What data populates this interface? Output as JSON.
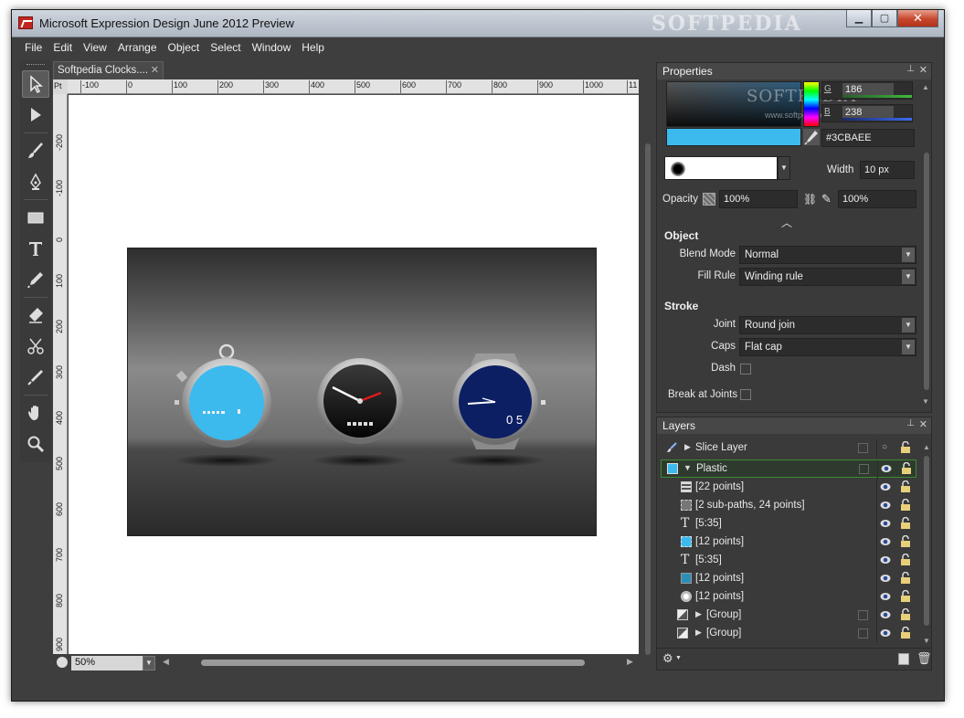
{
  "window": {
    "title": "Microsoft Expression Design June 2012 Preview",
    "watermark": "SOFTPEDIA",
    "buttons": {
      "minimize": "▁",
      "maximize": "▢",
      "close": "✕"
    }
  },
  "menu": [
    "File",
    "Edit",
    "View",
    "Arrange",
    "Object",
    "Select",
    "Window",
    "Help"
  ],
  "tools": [
    "selection",
    "direct-selection",
    "brush",
    "pen",
    "rectangle",
    "text",
    "eyedropper",
    "eraser",
    "scissors",
    "pipette",
    "hand",
    "zoom"
  ],
  "document": {
    "tab_title": "Softpedia Clocks....",
    "tab_close": "✕",
    "ruler_unit": "Pt",
    "ruler_h": [
      "-100",
      "0",
      "100",
      "200",
      "300",
      "400",
      "500",
      "600",
      "700",
      "800",
      "900",
      "1000",
      "11"
    ],
    "ruler_v": [
      "-200",
      "-100",
      "0",
      "100",
      "200",
      "300",
      "400",
      "500",
      "600",
      "700",
      "800",
      "900"
    ],
    "zoom": "50%",
    "watch_digits": "0 5"
  },
  "properties": {
    "title": "Properties",
    "pin": "⊥",
    "close": "✕",
    "watermark": "SOFTPEDIA",
    "watermark_url": "www.softpedia.com",
    "color": {
      "channel_g_label": "G",
      "channel_g_value": "186",
      "channel_b_label": "B",
      "channel_b_value": "238",
      "hex": "#3CBAEE",
      "swatch": "#3CBAEE"
    },
    "stroke": {
      "width_label": "Width",
      "width_value": "10 px",
      "opacity_label": "Opacity",
      "opacity_value": "100%",
      "opacity_value_2": "100%"
    },
    "object": {
      "title": "Object",
      "blend_mode_label": "Blend Mode",
      "blend_mode_value": "Normal",
      "fill_rule_label": "Fill Rule",
      "fill_rule_value": "Winding rule"
    },
    "stroke_section": {
      "title": "Stroke",
      "joint_label": "Joint",
      "joint_value": "Round join",
      "caps_label": "Caps",
      "caps_value": "Flat cap",
      "dash_label": "Dash",
      "break_label": "Break at Joints"
    }
  },
  "layers": {
    "title": "Layers",
    "pin": "⊥",
    "close": "✕",
    "items": [
      {
        "name": "Slice Layer",
        "icon": "brush-icon",
        "level": 0,
        "expand": "▶"
      },
      {
        "name": "Plastic",
        "icon": "layer-icon",
        "level": 0,
        "expand": "▼",
        "selected": true
      },
      {
        "name": "[22 points]",
        "icon": "path-icon",
        "level": 1
      },
      {
        "name": "[2 sub-paths, 24 points]",
        "icon": "path-icon",
        "level": 1
      },
      {
        "name": "[5:35]",
        "icon": "text-icon",
        "level": 1
      },
      {
        "name": "[12 points]",
        "icon": "path-icon",
        "level": 1
      },
      {
        "name": "[5:35]",
        "icon": "text-icon",
        "level": 1
      },
      {
        "name": "[12 points]",
        "icon": "path-icon",
        "level": 1
      },
      {
        "name": "[12 points]",
        "icon": "path-icon",
        "level": 1
      },
      {
        "name": "[Group]",
        "icon": "group-icon",
        "level": 1,
        "expand": "▶"
      },
      {
        "name": "[Group]",
        "icon": "group-icon",
        "level": 1,
        "expand": "▶"
      }
    ]
  },
  "colors": {
    "accent": "#3CBAEE",
    "panel_bg": "#3A3A3A",
    "selection": "#3B8B2E"
  }
}
